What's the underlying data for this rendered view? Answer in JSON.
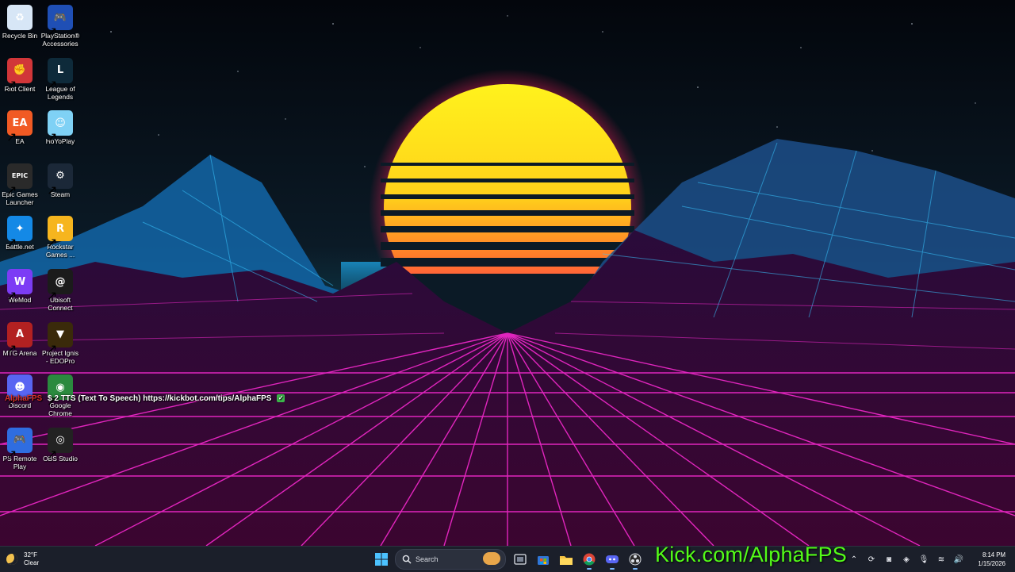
{
  "desktop": {
    "icons": [
      {
        "label": "Recycle Bin",
        "icon": "recycle-bin-icon",
        "color": "#d7e6f6",
        "glyph": "♻"
      },
      {
        "label": "PlayStation® Accessories",
        "icon": "playstation-accessories-icon",
        "color": "#1f4fb5",
        "glyph": "🎮"
      },
      {
        "label": "Riot Client",
        "icon": "riot-client-icon",
        "color": "#d13639",
        "glyph": "✊"
      },
      {
        "label": "League of Legends",
        "icon": "league-of-legends-icon",
        "color": "#0e2a3a",
        "glyph": "L"
      },
      {
        "label": "EA",
        "icon": "ea-icon",
        "color": "#f15a24",
        "glyph": "EA"
      },
      {
        "label": "HoYoPlay",
        "icon": "hoyoplay-icon",
        "color": "#7fd1f5",
        "glyph": "☺"
      },
      {
        "label": "Epic Games Launcher",
        "icon": "epic-games-icon",
        "color": "#2a2a2a",
        "glyph": "EPIC"
      },
      {
        "label": "Steam",
        "icon": "steam-icon",
        "color": "#1b2838",
        "glyph": "⚙"
      },
      {
        "label": "Battle.net",
        "icon": "battlenet-icon",
        "color": "#1489e6",
        "glyph": "✦"
      },
      {
        "label": "Rockstar Games ...",
        "icon": "rockstar-games-icon",
        "color": "#f6b51e",
        "glyph": "R"
      },
      {
        "label": "WeMod",
        "icon": "wemod-icon",
        "color": "#7c3cf5",
        "glyph": "W"
      },
      {
        "label": "Ubisoft Connect",
        "icon": "ubisoft-connect-icon",
        "color": "#1b1b1b",
        "glyph": "@"
      },
      {
        "label": "MTG Arena",
        "icon": "mtg-arena-icon",
        "color": "#b22121",
        "glyph": "A"
      },
      {
        "label": "Project Ignis - EDOPro",
        "icon": "edopro-icon",
        "color": "#3a2a0a",
        "glyph": "▼"
      },
      {
        "label": "Discord",
        "icon": "discord-icon",
        "color": "#5865f2",
        "glyph": "☻"
      },
      {
        "label": "Google Chrome",
        "icon": "chrome-icon",
        "color": "#2a8a3e",
        "glyph": "◉"
      },
      {
        "label": "PS Remote Play",
        "icon": "ps-remote-play-icon",
        "color": "#2f6de0",
        "glyph": "🎮"
      },
      {
        "label": "OBS Studio",
        "icon": "obs-studio-icon",
        "color": "#222222",
        "glyph": "◎"
      }
    ]
  },
  "chat": {
    "username": "AlphaFPS",
    "message": "$ 2 TTS (Text To Speech) https://kickbot.com/tips/AlphaFPS",
    "check": "✓"
  },
  "taskbar": {
    "weather": {
      "temp": "32°F",
      "condition": "Clear"
    },
    "search_label": "Search",
    "apps": [
      {
        "name": "start-button",
        "icon": "windows-logo-icon"
      },
      {
        "name": "task-view-button",
        "icon": "task-view-icon"
      },
      {
        "name": "microsoft-store-button",
        "icon": "store-icon"
      },
      {
        "name": "file-explorer-button",
        "icon": "folder-icon"
      },
      {
        "name": "chrome-button",
        "icon": "chrome-icon"
      },
      {
        "name": "discord-button",
        "icon": "discord-icon"
      },
      {
        "name": "obs-button",
        "icon": "obs-icon"
      }
    ],
    "overlay_text": "Kick.com/AlphaFPS",
    "clock": {
      "time": "8:14 PM",
      "date": "1/15/2026"
    },
    "colors": {
      "bg": "#1b1f2a",
      "accent": "#53fc18"
    }
  }
}
